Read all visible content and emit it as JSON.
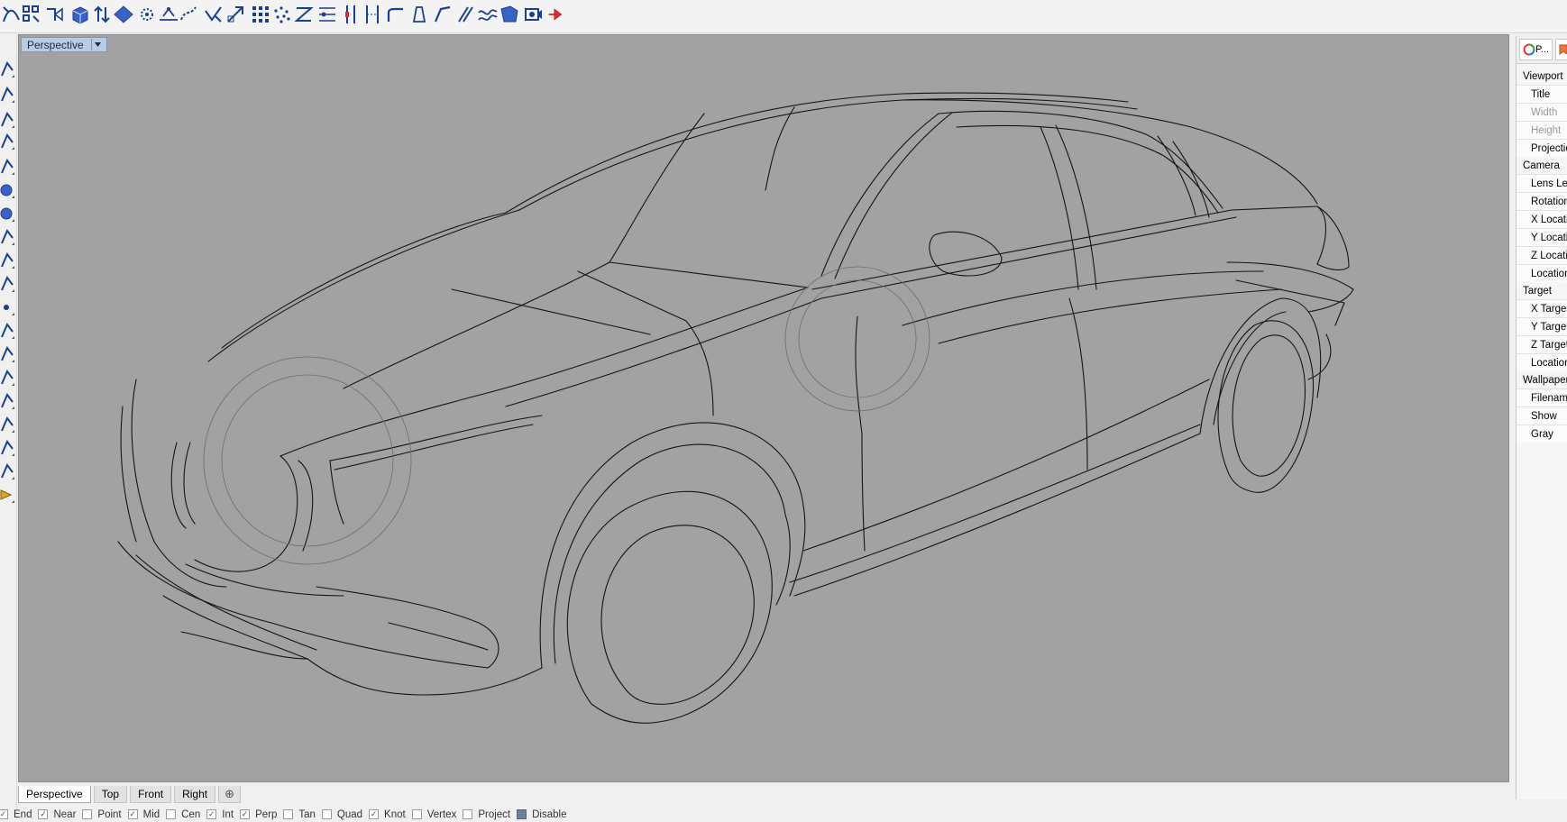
{
  "toolbar": {
    "icons": [
      "curve-tool-icon",
      "select-points-icon",
      "analyze-direction-icon",
      "box-solid-icon",
      "move-extrude-icon",
      "plane-surface-icon",
      "gumball-icon",
      "mesh-icon",
      "split-curve-icon",
      "trim-icon",
      "scale-icon",
      "array-icon",
      "point-cloud-icon",
      "arc-blend-icon",
      "align-icon",
      "extend-icon",
      "mirror-icon",
      "fillet-icon",
      "loft-icon",
      "sweep1-icon",
      "sweep2-icon",
      "network-surface-icon",
      "patch-icon",
      "camera-target-icon",
      "red-arrow-icon"
    ]
  },
  "viewport": {
    "title": "Perspective",
    "background_color": "#a2a2a2",
    "wire_color": "#141414"
  },
  "tabs": [
    {
      "label": "Perspective",
      "active": true
    },
    {
      "label": "Top",
      "active": false
    },
    {
      "label": "Front",
      "active": false
    },
    {
      "label": "Right",
      "active": false
    }
  ],
  "add_tab_symbol": "⊕",
  "osnaps": [
    {
      "label": "End",
      "checked": true
    },
    {
      "label": "Near",
      "checked": true
    },
    {
      "label": "Point",
      "checked": false
    },
    {
      "label": "Mid",
      "checked": true
    },
    {
      "label": "Cen",
      "checked": false
    },
    {
      "label": "Int",
      "checked": true
    },
    {
      "label": "Perp",
      "checked": true
    },
    {
      "label": "Tan",
      "checked": false
    },
    {
      "label": "Quad",
      "checked": false
    },
    {
      "label": "Knot",
      "checked": true
    },
    {
      "label": "Vertex",
      "checked": false
    },
    {
      "label": "Project",
      "checked": false
    },
    {
      "label": "Disable",
      "checked": false
    }
  ],
  "panel": {
    "tab_label": "P...",
    "sections": [
      {
        "title": "Viewport",
        "items": [
          {
            "label": "Title",
            "disabled": false
          },
          {
            "label": "Width",
            "disabled": true
          },
          {
            "label": "Height",
            "disabled": true
          },
          {
            "label": "Projection",
            "disabled": false
          }
        ]
      },
      {
        "title": "Camera",
        "items": [
          {
            "label": "Lens Length",
            "disabled": false
          },
          {
            "label": "Rotation",
            "disabled": false
          },
          {
            "label": "X Location",
            "disabled": false
          },
          {
            "label": "Y Location",
            "disabled": false
          },
          {
            "label": "Z Location",
            "disabled": false
          },
          {
            "label": "Location",
            "disabled": false
          }
        ]
      },
      {
        "title": "Target",
        "items": [
          {
            "label": "X Target",
            "disabled": false
          },
          {
            "label": "Y Target",
            "disabled": false
          },
          {
            "label": "Z Target",
            "disabled": false
          },
          {
            "label": "Location",
            "disabled": false
          }
        ]
      },
      {
        "title": "Wallpaper",
        "items": [
          {
            "label": "Filename",
            "disabled": false
          },
          {
            "label": "Show",
            "disabled": false
          },
          {
            "label": "Gray",
            "disabled": false
          }
        ]
      }
    ]
  }
}
